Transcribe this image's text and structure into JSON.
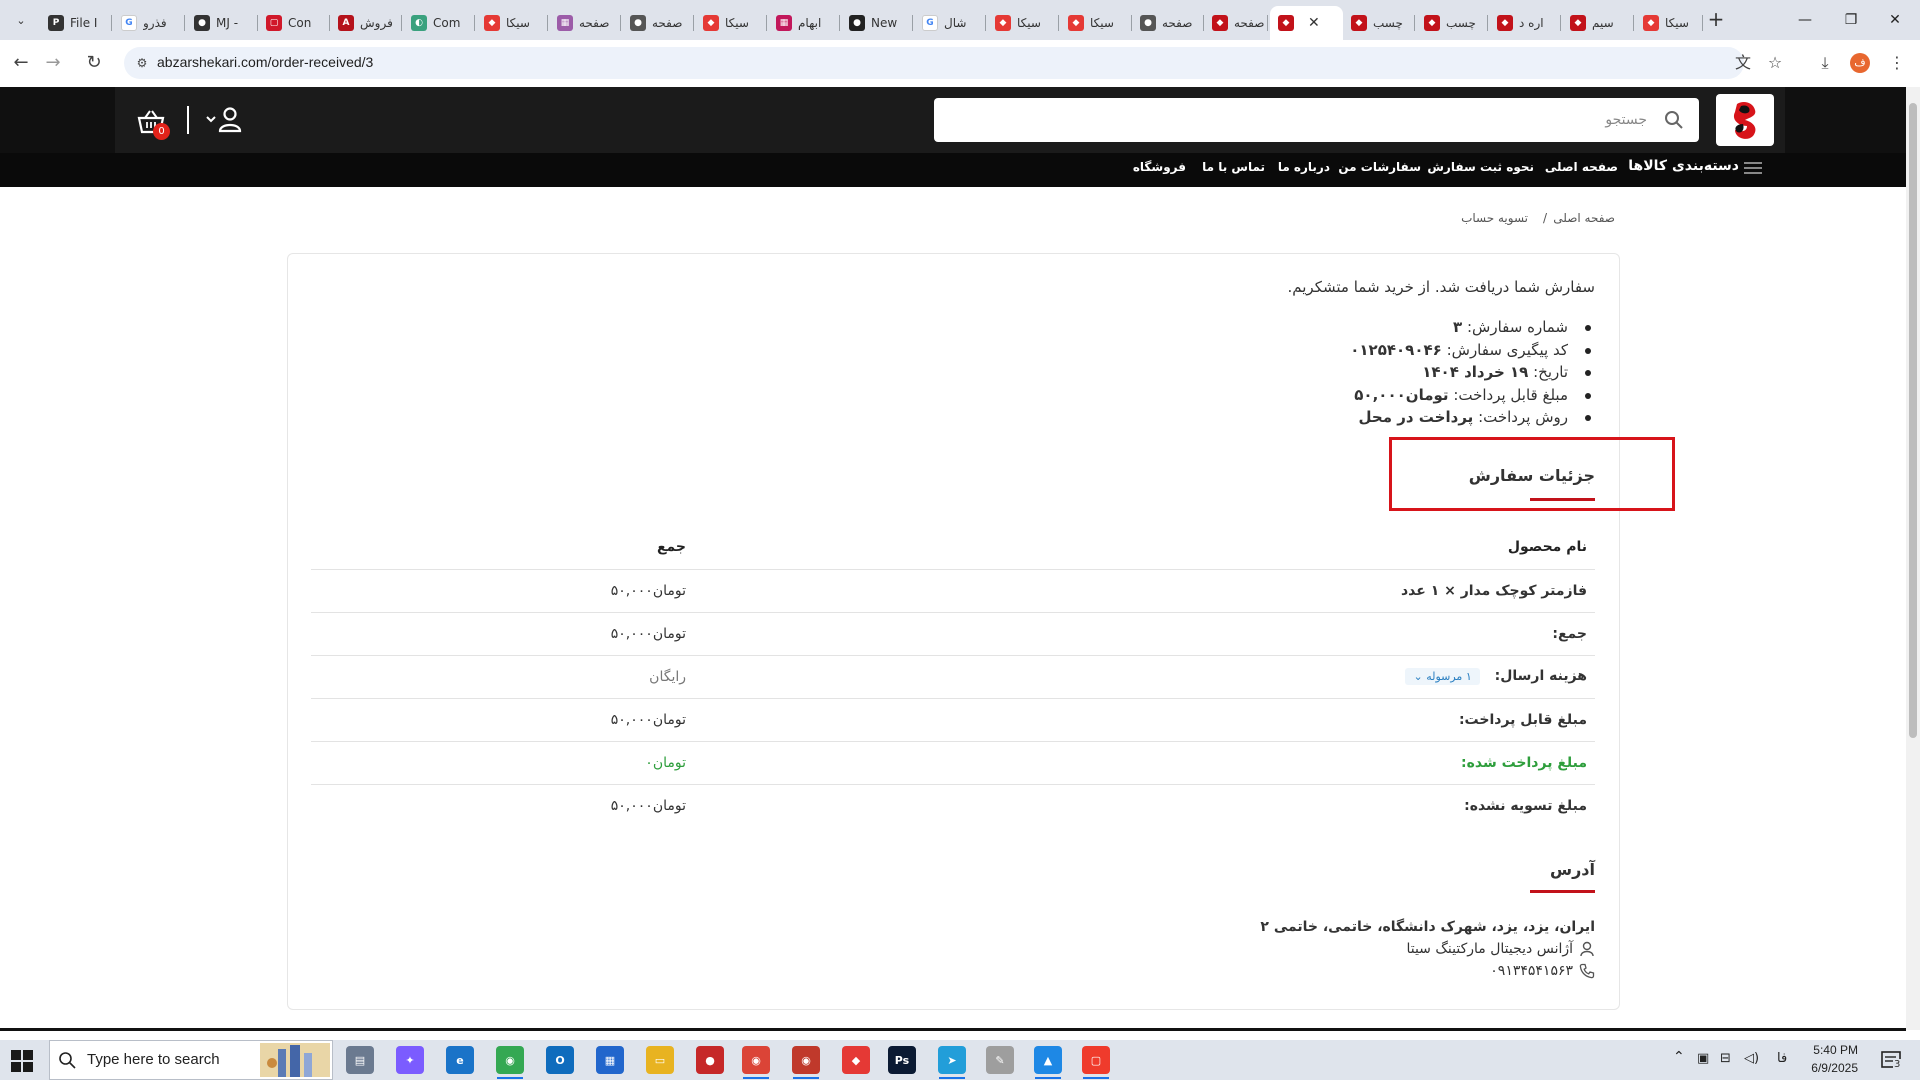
{
  "browser": {
    "tabs": [
      {
        "label": "File I",
        "fav_color": "#333333",
        "fav_glyph": "P"
      },
      {
        "label": "فذرو",
        "fav_color": "#ffffff",
        "fav_glyph": "G"
      },
      {
        "label": "MJ -",
        "fav_color": "#333333",
        "fav_glyph": "●"
      },
      {
        "label": "Con",
        "fav_color": "#d0182a",
        "fav_glyph": "▢"
      },
      {
        "label": "فروش",
        "fav_color": "#b5121b",
        "fav_glyph": "A"
      },
      {
        "label": "Com",
        "fav_color": "#3aa17e",
        "fav_glyph": "◐"
      },
      {
        "label": "سیکا",
        "fav_color": "#e53935",
        "fav_glyph": "◆"
      },
      {
        "label": "صفحه",
        "fav_color": "#9c5ca8",
        "fav_glyph": "▦"
      },
      {
        "label": "صفحه",
        "fav_color": "#555555",
        "fav_glyph": "●"
      },
      {
        "label": "سیکا",
        "fav_color": "#e53935",
        "fav_glyph": "◆"
      },
      {
        "label": "ابهام",
        "fav_color": "#c2185b",
        "fav_glyph": "▦"
      },
      {
        "label": "New",
        "fav_color": "#222222",
        "fav_glyph": "●"
      },
      {
        "label": "شال",
        "fav_color": "#ffffff",
        "fav_glyph": "G"
      },
      {
        "label": "سیکا",
        "fav_color": "#e53935",
        "fav_glyph": "◆"
      },
      {
        "label": "سیکا",
        "fav_color": "#e53935",
        "fav_glyph": "◆"
      },
      {
        "label": "صفحه",
        "fav_color": "#555555",
        "fav_glyph": "●"
      },
      {
        "label": "صفحه",
        "fav_color": "#c2121a",
        "fav_glyph": "◆"
      },
      {
        "label": "",
        "fav_color": "#c2121a",
        "fav_glyph": "◆",
        "active": true
      },
      {
        "label": "چسب",
        "fav_color": "#c2121a",
        "fav_glyph": "◆"
      },
      {
        "label": "چسب",
        "fav_color": "#c2121a",
        "fav_glyph": "◆"
      },
      {
        "label": "اره د",
        "fav_color": "#c2121a",
        "fav_glyph": "◆"
      },
      {
        "label": "سیم",
        "fav_color": "#c2121a",
        "fav_glyph": "◆"
      },
      {
        "label": "سیکا",
        "fav_color": "#e53935",
        "fav_glyph": "◆"
      }
    ],
    "close_tab_glyph": "✕",
    "new_tab_glyph": "+",
    "url": "abzarshekari.com/order-received/3",
    "profile_initial": "ف"
  },
  "site": {
    "search_placeholder": "جستجو",
    "cart_count": "0",
    "nav": {
      "categories": "دسته‌بندی کالاها",
      "home": "صفحه اصلی",
      "how_to_order": "نحوه ثبت سفارش",
      "my_orders": "سفارشات من",
      "about": "درباره ما",
      "contact": "تماس با ما",
      "shop": "فروشگاه"
    },
    "breadcrumb": {
      "home": "صفحه اصلی",
      "separator": "/",
      "current": "تسویه حساب"
    }
  },
  "order": {
    "thanks": "سفارش شما دریافت شد. از خرید شما متشکریم.",
    "overview": [
      {
        "label": "شماره سفارش:",
        "value": "۳"
      },
      {
        "label": "کد پیگیری سفارش:",
        "value": "۰۱۲۵۴۰۹۰۴۶"
      },
      {
        "label": "تاریخ:",
        "value": "۱۹ خرداد ۱۴۰۴"
      },
      {
        "label": "مبلغ قابل پرداخت:",
        "value": "تومان۵۰,۰۰۰"
      },
      {
        "label": "روش پرداخت:",
        "value": "پرداخت در محل"
      }
    ],
    "details_title": "جزئیات سفارش",
    "table": {
      "col_product": "نام محصول",
      "col_total": "جمع",
      "item_name": "فازمتر کوچک مدار",
      "item_qty": "× ۱ عدد",
      "item_total": "تومان۵۰,۰۰۰",
      "subtotal_label": "جمع:",
      "subtotal_value": "تومان۵۰,۰۰۰",
      "shipping_label": "هزینه ارسال:",
      "shipping_badge": "۱ مرسوله",
      "shipping_value": "رایگان",
      "payable_label": "مبلغ قابل پرداخت:",
      "payable_value": "تومان۵۰,۰۰۰",
      "paid_label": "مبلغ پرداخت شده:",
      "paid_value": "تومان۰",
      "unsettled_label": "مبلغ تسویه نشده:",
      "unsettled_value": "تومان۵۰,۰۰۰"
    },
    "address_title": "آدرس",
    "address_line": "ایران، یزد، یزد، شهرک دانشگاه، خاتمی، خاتمی ۲",
    "address_name": "آژانس دیجیتال مارکتینگ سیتا",
    "address_phone": "۰۹۱۳۴۵۴۱۵۶۳"
  },
  "taskbar": {
    "search_text": "Type here to search",
    "ime": "فا",
    "time": "5:40 PM",
    "date": "6/9/2025",
    "notification_count": "3",
    "apps": [
      {
        "name": "task-view",
        "color": "#6b7a90",
        "glyph": "▤"
      },
      {
        "name": "copilot",
        "color": "#7b5cff",
        "glyph": "✦"
      },
      {
        "name": "edge",
        "color": "#1a73c8",
        "glyph": "e"
      },
      {
        "name": "chrome",
        "color": "#34a853",
        "glyph": "◉"
      },
      {
        "name": "outlook",
        "color": "#0f6cbd",
        "glyph": "O"
      },
      {
        "name": "store",
        "color": "#2266cc",
        "glyph": "▦"
      },
      {
        "name": "file-explorer",
        "color": "#e8b321",
        "glyph": "▭"
      },
      {
        "name": "recorder",
        "color": "#c62828",
        "glyph": "●"
      },
      {
        "name": "chrome-profile",
        "color": "#db4437",
        "glyph": "◉"
      },
      {
        "name": "chrome-profile-2",
        "color": "#c0392b",
        "glyph": "◉"
      },
      {
        "name": "anydesk",
        "color": "#e53935",
        "glyph": "◆"
      },
      {
        "name": "photoshop",
        "color": "#0b1a33",
        "glyph": "Ps"
      },
      {
        "name": "telegram",
        "color": "#229ed9",
        "glyph": "➤"
      },
      {
        "name": "feather-app",
        "color": "#9e9e9e",
        "glyph": "✎"
      },
      {
        "name": "photos",
        "color": "#1e88e5",
        "glyph": "▲"
      },
      {
        "name": "anydesk-2",
        "color": "#ef3b2c",
        "glyph": "▢"
      }
    ]
  }
}
